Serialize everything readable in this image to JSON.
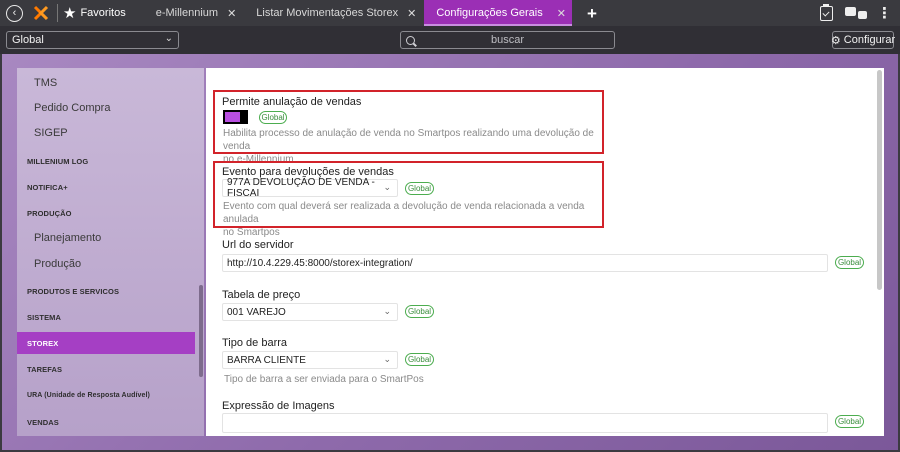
{
  "tabs": {
    "favorites_label": "Favoritos",
    "items": [
      {
        "label": "e-Millennium",
        "close": "✕"
      },
      {
        "label": "Listar Movimentações Storex",
        "close": "✕"
      },
      {
        "label": "Configurações Gerais",
        "close": "✕"
      }
    ],
    "add": "+"
  },
  "toolbar": {
    "scope_value": "Global",
    "search_placeholder": "buscar",
    "config_button_label": "Configurar"
  },
  "sidebar": {
    "items": [
      {
        "label": "TMS"
      },
      {
        "label": "Pedido Compra"
      },
      {
        "label": "SIGEP"
      },
      {
        "label": "MILLENIUM LOG"
      },
      {
        "label": "NOTIFICA+"
      },
      {
        "label": "PRODUÇÃO"
      },
      {
        "label": "Planejamento"
      },
      {
        "label": "Produção"
      },
      {
        "label": "PRODUTOS E SERVICOS"
      },
      {
        "label": "SISTEMA"
      },
      {
        "label": "STOREX"
      },
      {
        "label": "TAREFAS"
      },
      {
        "label": "URA (Unidade de Resposta Audível)"
      },
      {
        "label": "VENDAS"
      }
    ],
    "active_item": "STOREX"
  },
  "settings": {
    "badge_label": "Global",
    "anulacao": {
      "label": "Permite anulação de vendas",
      "enabled": true,
      "help_line1": "Habilita processo de anulação de venda no Smartpos realizando uma devolução de venda",
      "help_line2": "no e-Millennium"
    },
    "evento": {
      "label": "Evento para devoluções de vendas",
      "value": "977A DEVOLUÇÃO DE VENDA - FISCAI",
      "help_line1": "Evento com qual deverá ser realizada a devolução de venda relacionada a venda anulada",
      "help_line2": "no Smartpos"
    },
    "url": {
      "label": "Url do servidor",
      "value": "http://10.4.229.45:8000/storex-integration/"
    },
    "tabela": {
      "label": "Tabela de preço",
      "value": "001 VAREJO"
    },
    "barra": {
      "label": "Tipo de barra",
      "value": "BARRA CLIENTE",
      "help": "Tipo de barra a ser enviada para o SmartPos"
    },
    "imagens": {
      "label": "Expressão de Imagens",
      "value": ""
    }
  },
  "colors": {
    "active_tab": "#9b2fb5",
    "active_nav": "#a53fc4",
    "badge_green": "#4cad4f",
    "highlight_red": "#d2232a",
    "toggle_on": "#b84fe0"
  }
}
